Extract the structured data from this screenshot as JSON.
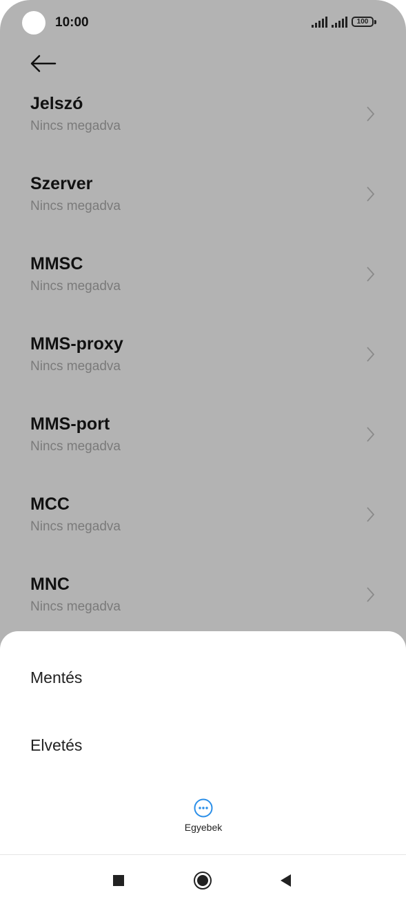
{
  "status_bar": {
    "time": "10:00",
    "battery": "100",
    "icons": [
      "signal-icon",
      "signal-icon",
      "battery-icon"
    ]
  },
  "header": {
    "back_icon": "arrow-left-icon"
  },
  "list": {
    "items": [
      {
        "title": "Jelszó",
        "subtitle": "Nincs megadva"
      },
      {
        "title": "Szerver",
        "subtitle": "Nincs megadva"
      },
      {
        "title": "MMSC",
        "subtitle": "Nincs megadva"
      },
      {
        "title": "MMS-proxy",
        "subtitle": "Nincs megadva"
      },
      {
        "title": "MMS-port",
        "subtitle": "Nincs megadva"
      },
      {
        "title": "MCC",
        "subtitle": "Nincs megadva"
      },
      {
        "title": "MNC",
        "subtitle": "Nincs megadva"
      }
    ],
    "chevron_icon": "chevron-right-icon"
  },
  "sheet": {
    "save_label": "Mentés",
    "discard_label": "Elvetés",
    "more_label": "Egyebek",
    "more_icon": "more-dots-icon",
    "accent": "#2a8ee8"
  },
  "nav_bar": {
    "icons": [
      "recents-square-icon",
      "home-circle-icon",
      "back-triangle-icon"
    ]
  }
}
